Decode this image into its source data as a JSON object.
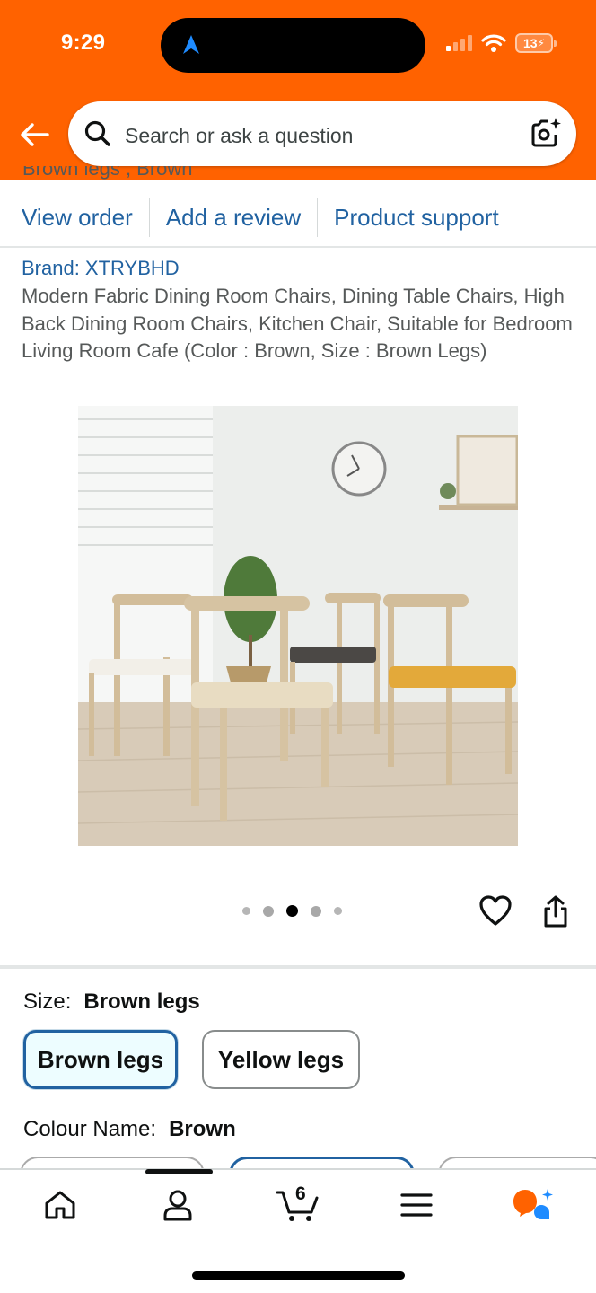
{
  "status_bar": {
    "time": "9:29",
    "battery": "13"
  },
  "header": {
    "search_placeholder": "Search or ask a question",
    "brand_color": "#ff6200"
  },
  "order": {
    "clipped_text": "Brown legs , Brown",
    "actions": [
      {
        "label": "View order"
      },
      {
        "label": "Add a review"
      },
      {
        "label": "Product support"
      }
    ]
  },
  "product": {
    "brand": "Brand: XTRYBHD",
    "title": "Modern Fabric Dining Room Chairs, Dining Table Chairs, High Back Dining Room Chairs, Kitchen Chair, Suitable for Bedroom Living Room Cafe (Color : Brown, Size : Brown Legs)",
    "image_index": 3,
    "image_count": 5
  },
  "options": {
    "size_label": "Size:",
    "size_value": "Brown legs",
    "size_chips": [
      {
        "label": "Brown legs",
        "selected": true
      },
      {
        "label": "Yellow legs",
        "selected": false
      }
    ],
    "colour_label": "Colour Name:",
    "colour_value": "Brown"
  },
  "bottom_nav": {
    "cart_count": "6",
    "items": [
      "home-icon",
      "account-icon",
      "cart-icon",
      "menu-icon",
      "rufus-icon"
    ]
  },
  "colors": {
    "link": "#2162a1",
    "selected_chip_bg": "#edfdff"
  }
}
